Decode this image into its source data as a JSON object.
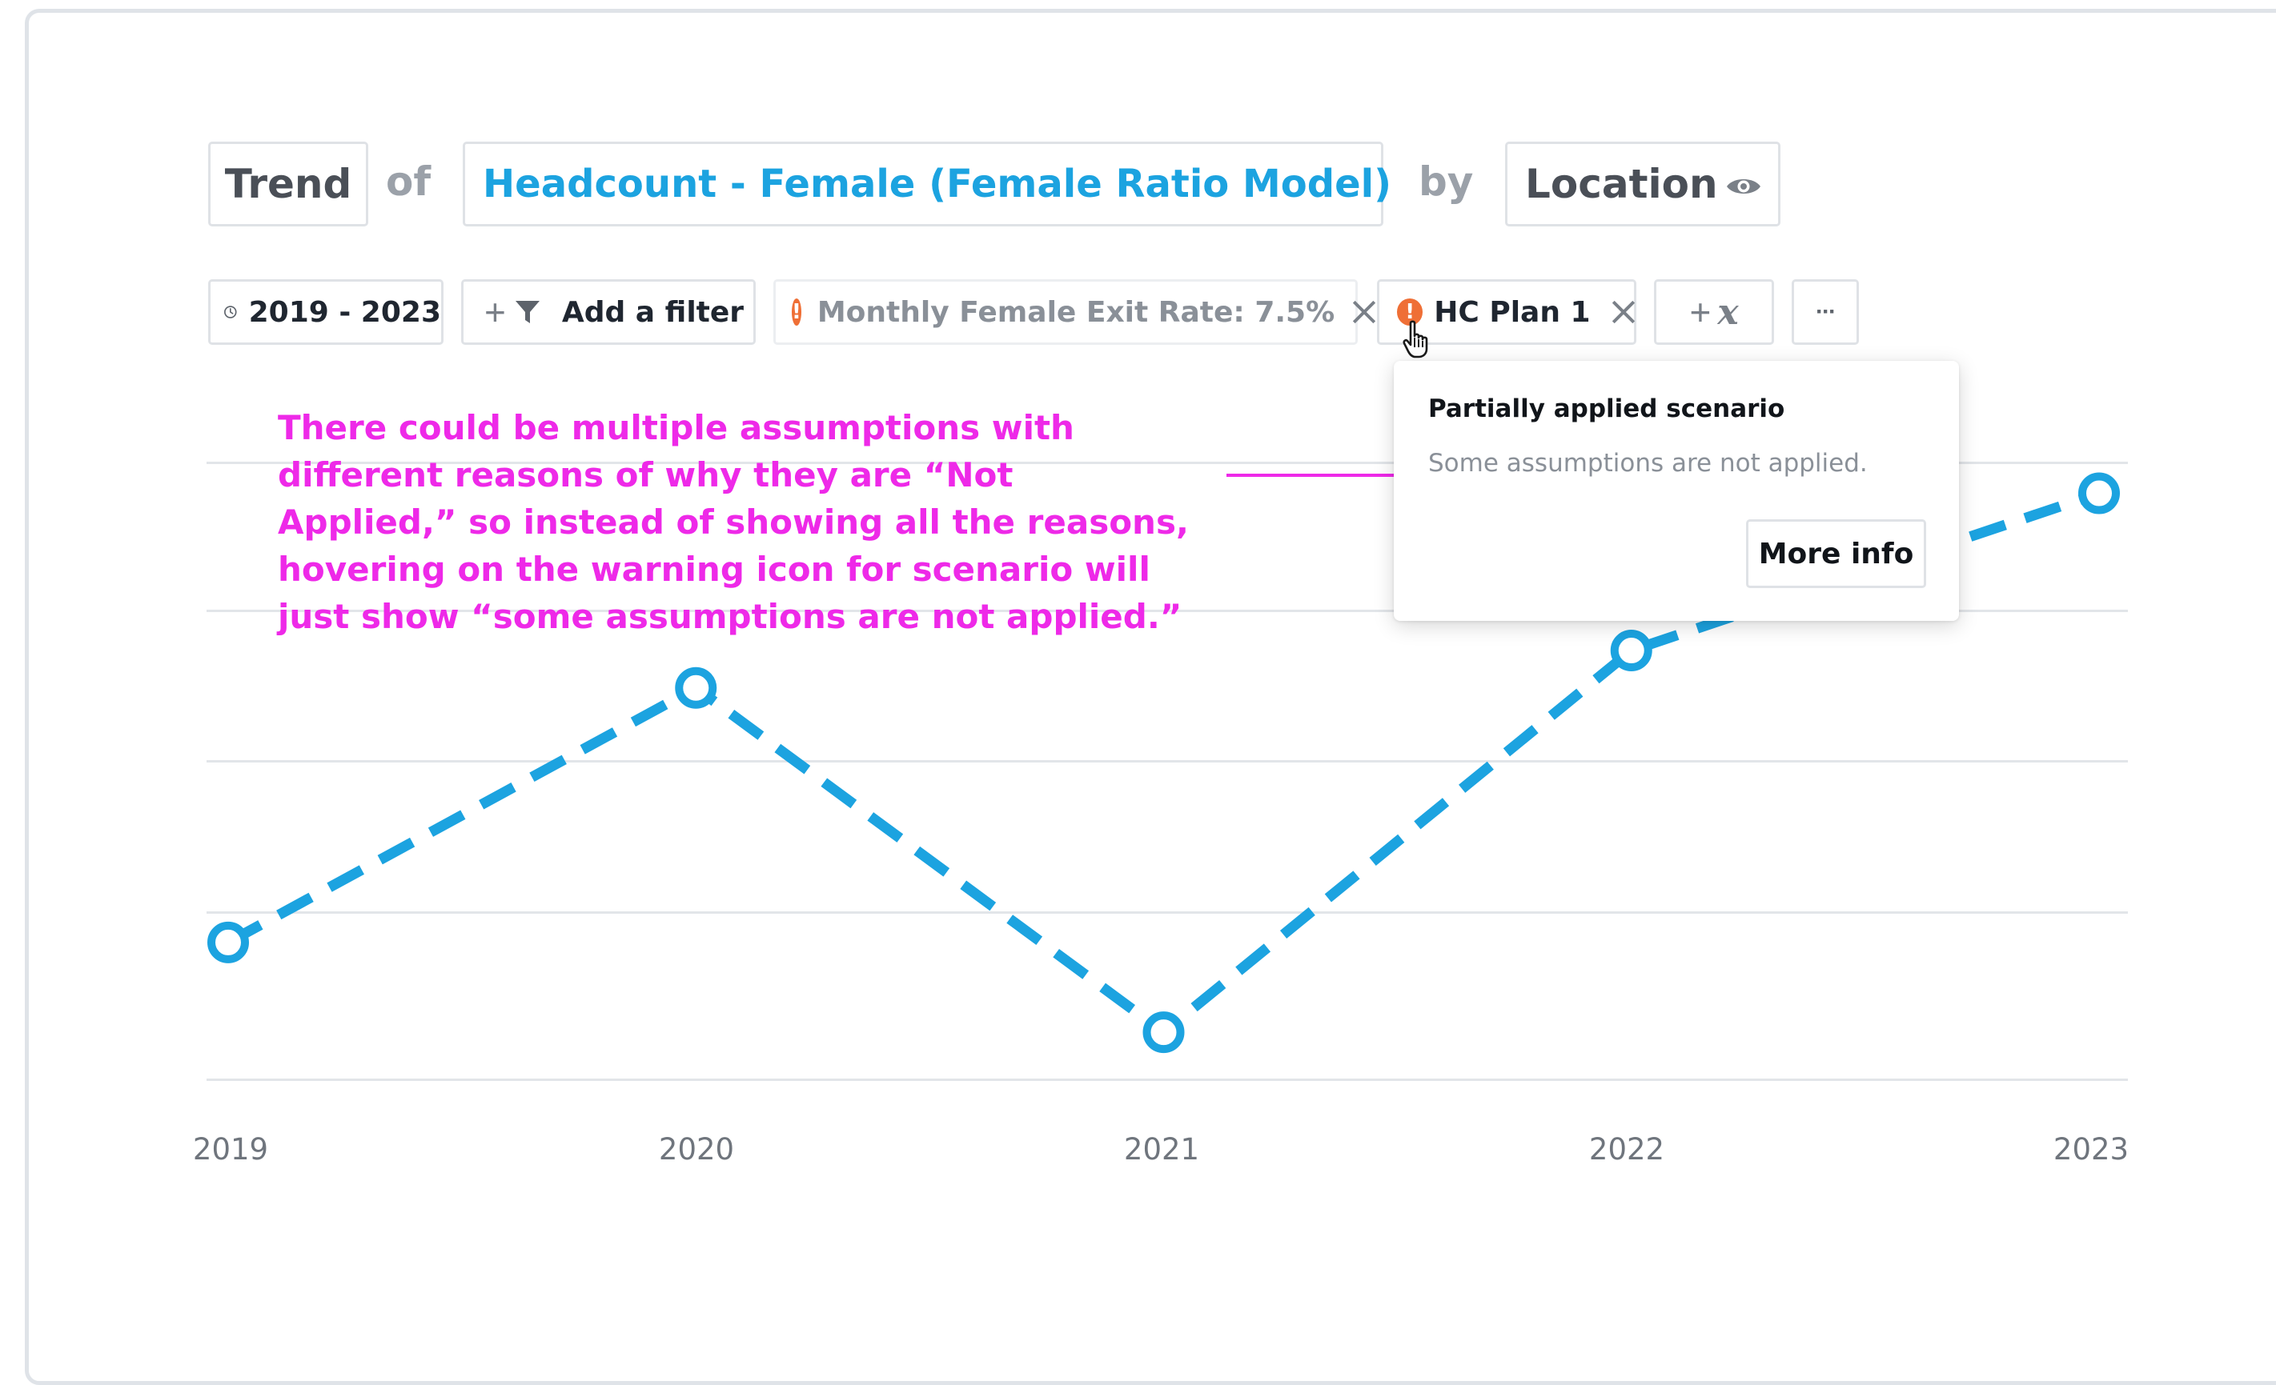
{
  "query": {
    "type_label": "Trend",
    "of_word": "of",
    "metric_label": "Headcount - Female (Female Ratio Model)",
    "by_word": "by",
    "dimension_label": "Location"
  },
  "toolbar": {
    "date_range": "2019 - 2023",
    "add_filter_label": "Add a filter",
    "assumption_chip": {
      "label": "Monthly Female Exit Rate: 7.5%",
      "status": "warning"
    },
    "scenario_chip": {
      "label": "HC Plan 1",
      "status": "warning"
    },
    "add_formula_symbol": "x",
    "more_label": "···"
  },
  "popup": {
    "title": "Partially applied scenario",
    "text": "Some assumptions are not applied.",
    "button_label": "More info"
  },
  "annotation": {
    "text": "There could be multiple assumptions with different reasons of why they are “Not Applied,” so instead of showing all the reasons, hovering on the warning icon for scenario will just show “some assumptions are not applied.”"
  },
  "colors": {
    "accent": "#1ca3e0",
    "warning": "#ef6f36",
    "annotation": "#ee29e8",
    "text_dark": "#4a4f57",
    "text_muted": "#9ba1a9"
  },
  "chart_data": {
    "type": "line",
    "x": [
      "2019",
      "2020",
      "2021",
      "2022",
      "2023"
    ],
    "values": [
      1.0,
      2.7,
      0.4,
      2.95,
      4.0
    ],
    "ylim": [
      0,
      4.5
    ],
    "line_style": "dashed",
    "markers": "hollow-circle",
    "grid": true,
    "legend": "none"
  }
}
